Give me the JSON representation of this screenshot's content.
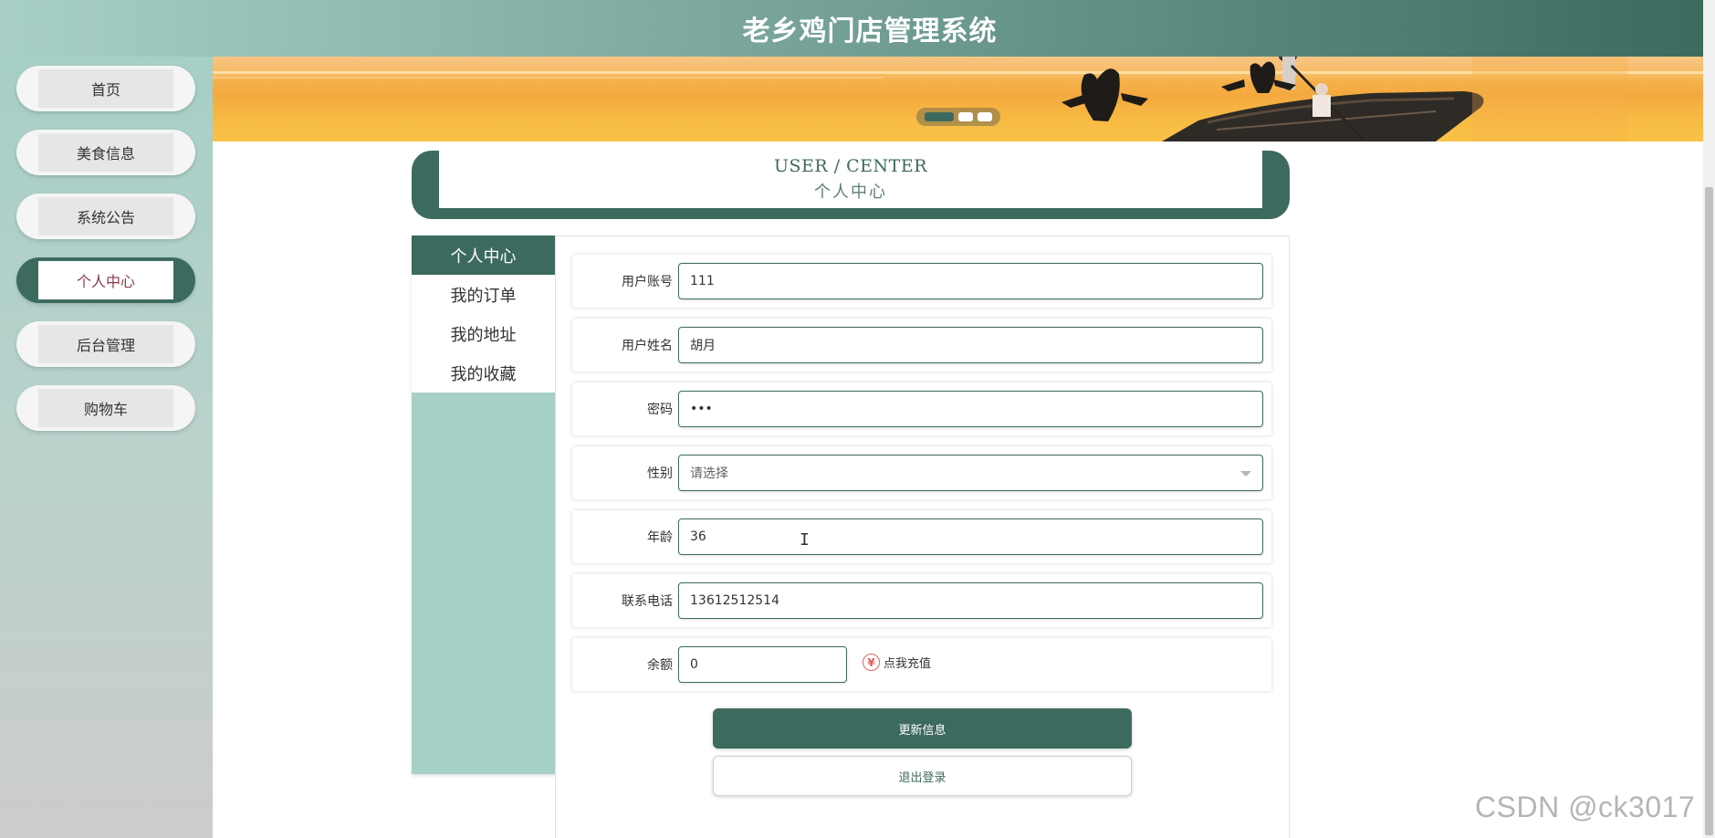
{
  "header": {
    "title": "老乡鸡门店管理系统"
  },
  "sidebar": {
    "items": [
      {
        "label": "首页"
      },
      {
        "label": "美食信息"
      },
      {
        "label": "系统公告"
      },
      {
        "label": "个人中心",
        "active": true
      },
      {
        "label": "后台管理"
      },
      {
        "label": "购物车"
      }
    ]
  },
  "banner": {
    "dots": 3,
    "active_dot": 1
  },
  "user_center": {
    "title_en": "USER / CENTER",
    "title_cn": "个人中心"
  },
  "side_menu": {
    "items": [
      {
        "label": "个人中心",
        "active": true
      },
      {
        "label": "我的订单"
      },
      {
        "label": "我的地址"
      },
      {
        "label": "我的收藏"
      }
    ]
  },
  "form": {
    "account": {
      "label": "用户账号",
      "value": "111"
    },
    "name": {
      "label": "用户姓名",
      "value": "胡月"
    },
    "password": {
      "label": "密码",
      "value": "•••"
    },
    "gender": {
      "label": "性别",
      "placeholder": "请选择"
    },
    "age": {
      "label": "年龄",
      "value": "36"
    },
    "phone": {
      "label": "联系电话",
      "value": "13612512514"
    },
    "balance": {
      "label": "余额",
      "value": "0",
      "recharge_label": "点我充值"
    }
  },
  "buttons": {
    "update": "更新信息",
    "logout": "退出登录"
  },
  "watermark": "CSDN @ck3017",
  "colors": {
    "primary": "#3d6a5e",
    "sidebar": "#a6cfc6",
    "accent_text": "#8a3a48"
  }
}
